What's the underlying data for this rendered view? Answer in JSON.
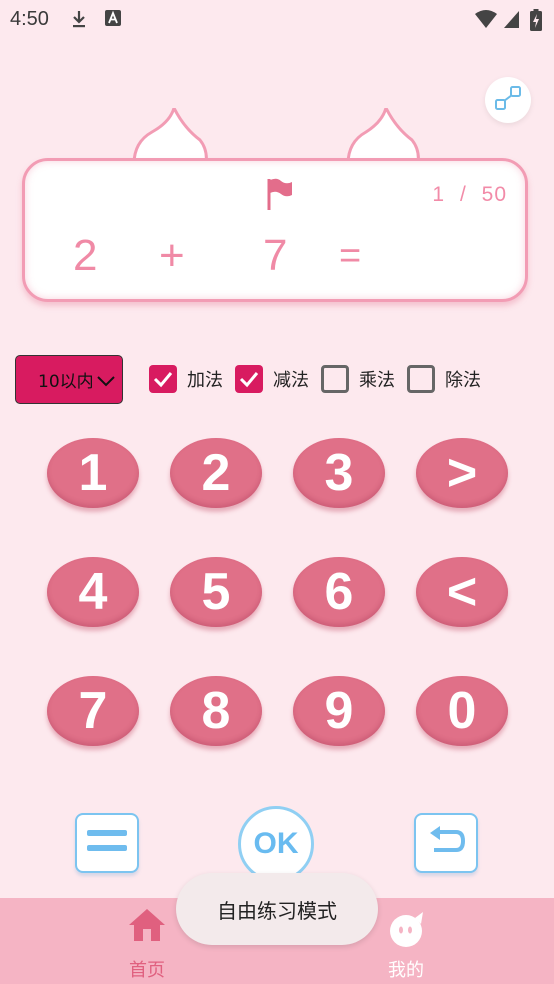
{
  "status_bar": {
    "time": "4:50",
    "icons": [
      "download-icon",
      "text-a-icon",
      "wifi-icon",
      "signal-icon",
      "battery-charging-icon"
    ]
  },
  "question": {
    "progress_current": "1",
    "progress_separator": "/",
    "progress_total": "50",
    "operand1": "2",
    "operator": "+",
    "operand2": "7",
    "equals": "=",
    "answer": ""
  },
  "options": {
    "range": "10以内",
    "modes": [
      {
        "label": "加法",
        "checked": true
      },
      {
        "label": "减法",
        "checked": true
      },
      {
        "label": "乘法",
        "checked": false
      },
      {
        "label": "除法",
        "checked": false
      }
    ]
  },
  "keypad": {
    "keys": [
      "1",
      "2",
      "3",
      ">",
      "4",
      "5",
      "6",
      "<",
      "7",
      "8",
      "9",
      "0"
    ]
  },
  "actions": {
    "ok_label": "OK"
  },
  "toast": "自由练习模式",
  "nav": {
    "home_label": "首页",
    "me_label": "我的"
  },
  "colors": {
    "background": "#fde9ee",
    "key": "#e07088",
    "accent": "#d81b60",
    "card_border": "#f29cb4",
    "nav": "#f5b4c4",
    "button_blue": "#7cc4f0"
  }
}
